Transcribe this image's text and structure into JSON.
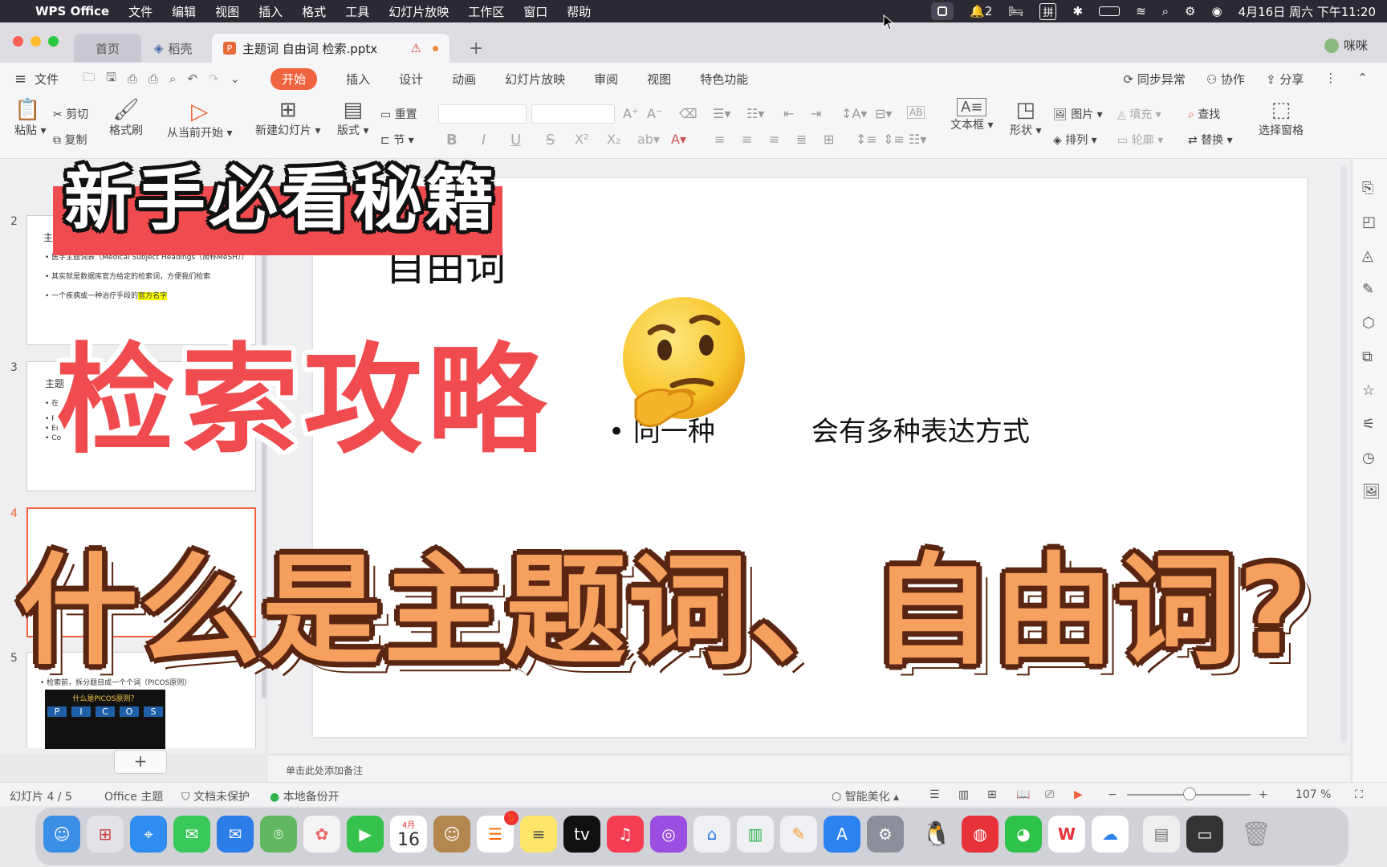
{
  "menubar": {
    "app": "WPS Office",
    "items": [
      "文件",
      "编辑",
      "视图",
      "插入",
      "格式",
      "工具",
      "幻灯片放映",
      "工作区",
      "窗口",
      "帮助"
    ],
    "notif_count": "2",
    "ime": "拼",
    "datetime": "4月16日 周六 下午11:20"
  },
  "tabs": {
    "home": "首页",
    "daoke": "稻壳",
    "doc": "主题词 自由词 检索.pptx",
    "add": "+",
    "user": "咪咪"
  },
  "menurow": {
    "file": "文件",
    "tabs": [
      "开始",
      "插入",
      "设计",
      "动画",
      "幻灯片放映",
      "审阅",
      "视图",
      "特色功能"
    ],
    "right": [
      "同步异常",
      "协作",
      "分享"
    ]
  },
  "ribbon": {
    "paste": "粘贴",
    "cut": "剪切",
    "copy": "复制",
    "format_painter": "格式刷",
    "from_current": "从当前开始",
    "new_slide": "新建幻灯片",
    "layout": "版式",
    "reset": "重置",
    "section": "节",
    "textbox": "文本框",
    "shape": "形状",
    "picture": "图片",
    "fill": "填充",
    "arrange": "排列",
    "outline": "轮廓",
    "find": "查找",
    "replace": "替换",
    "selection_pane": "选择窗格"
  },
  "slides_panel": {
    "nums": [
      "2",
      "3",
      "4",
      "5"
    ],
    "s2": {
      "title": "主",
      "l1": "• 医学主题词表（Medical Subject Headings（简称MeSH））",
      "l2": "• 其实就是数据库官方给定的检索词，方便我们检索",
      "l3a": "• 一个疾病或一种治疗手段的",
      "l3b": "官方名字"
    },
    "s3": {
      "title": "主题",
      "l1": "• 在",
      "l2": "• Pu",
      "l3": "• Em",
      "l4": "• Co"
    },
    "s5": {
      "title": "检索",
      "l1": "• 检索前，拆分题目成一个个词（PICOS原则）",
      "banner": "什么是PICOS原则？",
      "letters": [
        "P",
        "I",
        "C",
        "O",
        "S"
      ]
    }
  },
  "slide": {
    "title": "自由词",
    "line1a": "• 同一种",
    "line1b": "会有多种表达方式"
  },
  "notes_placeholder": "单击此处添加备注",
  "statusbar": {
    "slide_indicator": "幻灯片 4 / 5",
    "theme": "Office 主题",
    "protect": "文档未保护",
    "backup": "本地备份开",
    "beautify": "智能美化",
    "zoom": "107 %"
  },
  "overlay": {
    "line1": "新手必看秘籍",
    "line2": "检索攻略",
    "line3": "什么是主题词、自由词?"
  },
  "dock": {
    "calendar_month": "4月",
    "calendar_day": "16",
    "reminders_badge": "5"
  },
  "colors": {
    "accent": "#f0633f",
    "overlay_red": "#f04c50",
    "overlay_orange": "#f5a05f",
    "overlay_outline": "#5a2612"
  }
}
